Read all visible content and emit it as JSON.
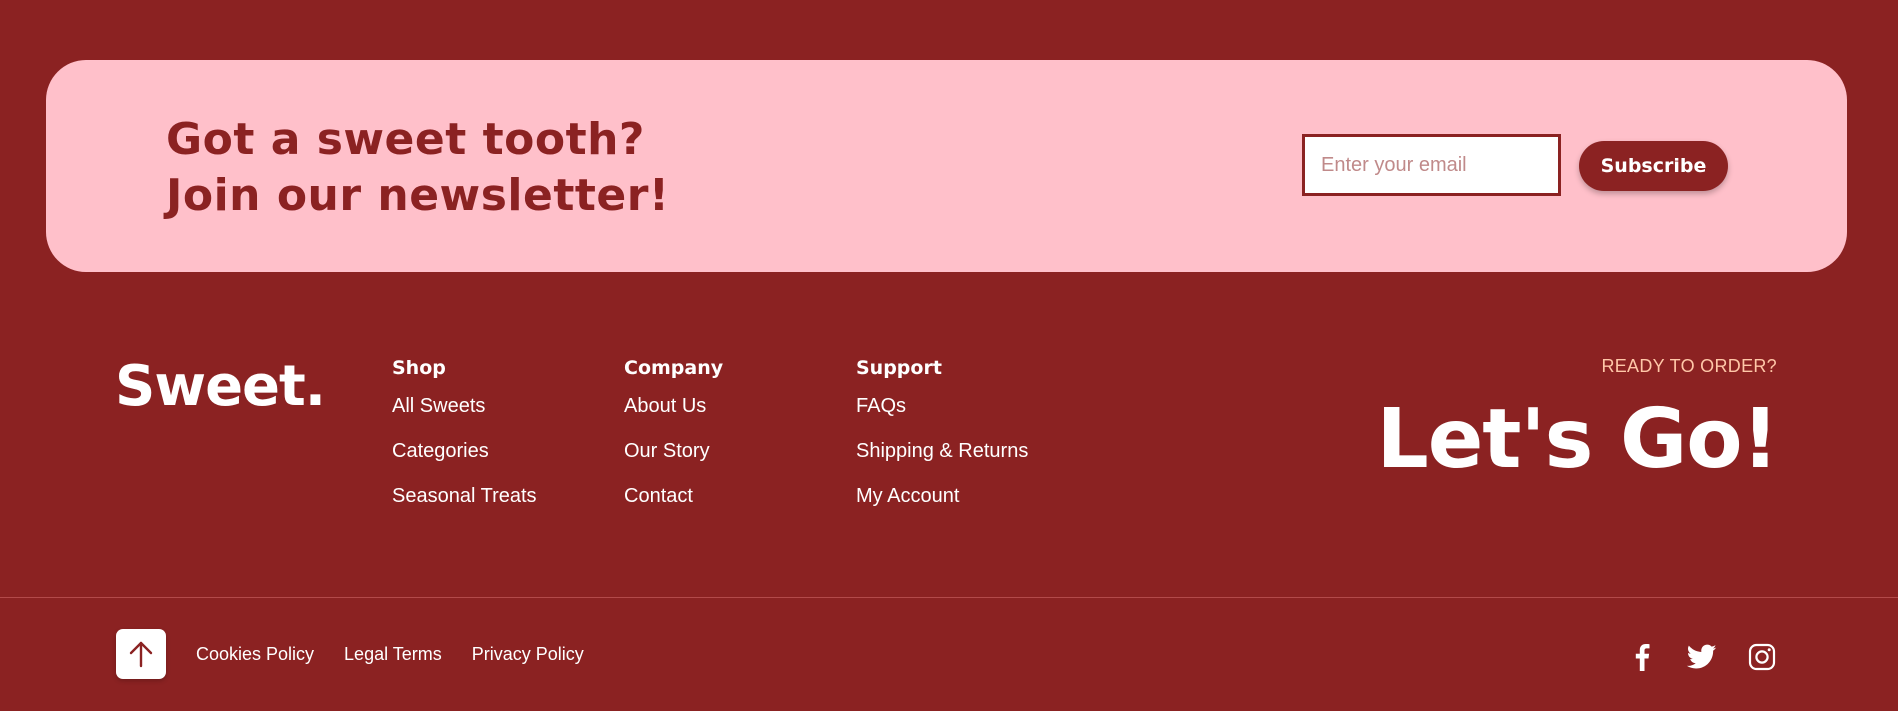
{
  "newsletter": {
    "title_line1": "Got a sweet tooth?",
    "title_line2": "Join our newsletter!",
    "email_placeholder": "Enter your email",
    "subscribe_label": "Subscribe"
  },
  "brand": {
    "name": "Sweet."
  },
  "columns": [
    {
      "heading": "Shop",
      "links": [
        "All Sweets",
        "Categories",
        "Seasonal Treats"
      ]
    },
    {
      "heading": "Company",
      "links": [
        "About Us",
        "Our Story",
        "Contact"
      ]
    },
    {
      "heading": "Support",
      "links": [
        "FAQs",
        "Shipping & Returns",
        "My Account"
      ]
    }
  ],
  "cta": {
    "kicker": "READY TO ORDER?",
    "headline": "Let's Go!"
  },
  "bottom_bar": {
    "back_to_top_icon": "arrow-up-icon",
    "legal_links": [
      "Cookies Policy",
      "Legal Terms",
      "Privacy Policy"
    ],
    "social_icons": [
      "facebook-icon",
      "twitter-icon",
      "instagram-icon"
    ]
  },
  "colors": {
    "background": "#8b2222",
    "newsletter_card": "#ffc0ca",
    "accent_text": "#ffc7a8",
    "white": "#ffffff"
  }
}
